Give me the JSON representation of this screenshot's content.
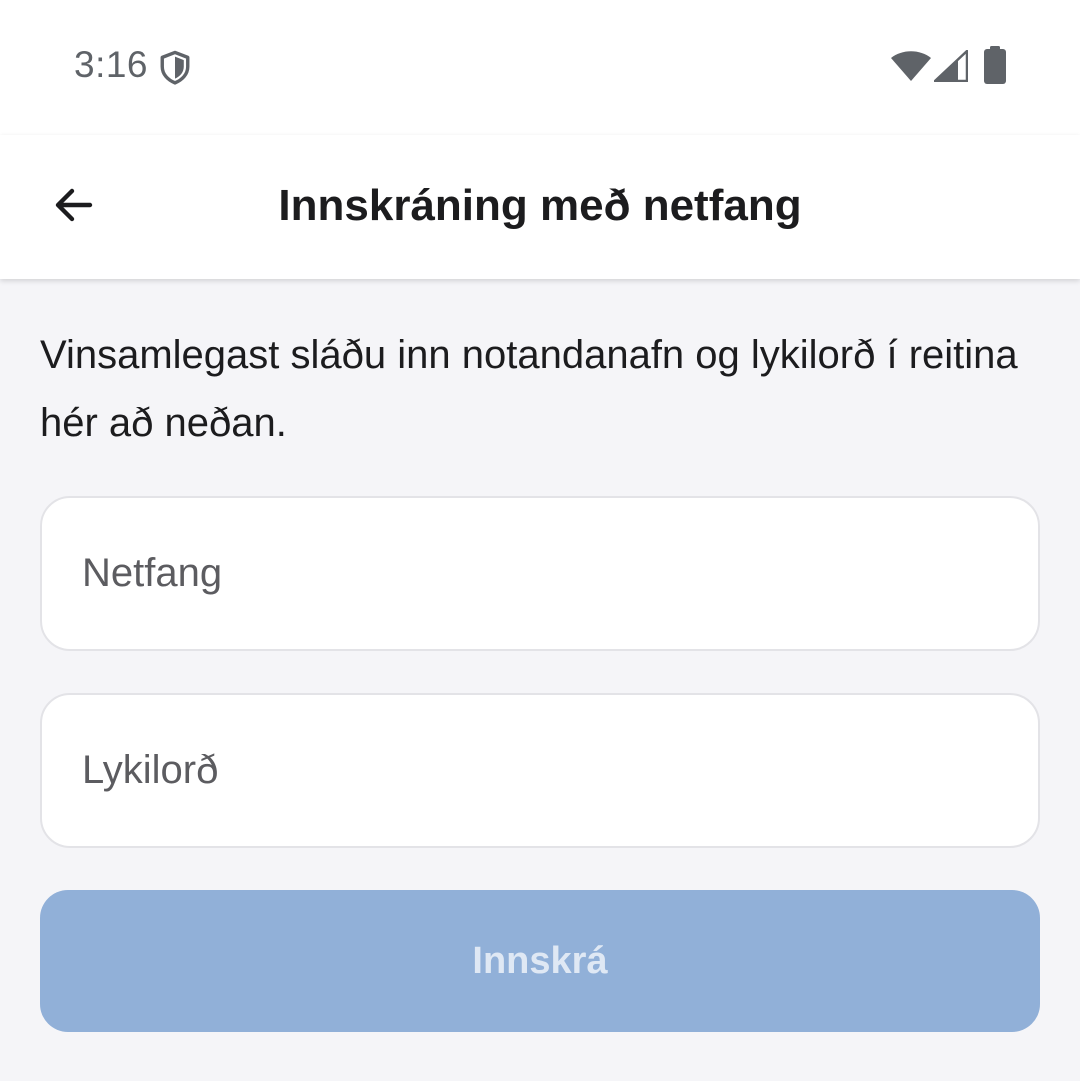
{
  "status_bar": {
    "time": "3:16",
    "icons": [
      "shield-icon",
      "wifi-icon",
      "signal-icon",
      "battery-icon"
    ]
  },
  "app_bar": {
    "back_icon": "arrow-left-icon",
    "title": "Innskráning með netfang"
  },
  "form": {
    "instructions": "Vinsamlegast sláðu inn notandanafn og lykilorð í reitina hér að neðan.",
    "email": {
      "value": "",
      "placeholder": "Netfang"
    },
    "password": {
      "value": "",
      "placeholder": "Lykilorð"
    },
    "submit_label": "Innskrá",
    "submit_enabled": false
  },
  "colors": {
    "background": "#f5f5f8",
    "surface": "#ffffff",
    "button_disabled": "#91b0d8",
    "button_text_disabled": "#dfe8f4"
  }
}
